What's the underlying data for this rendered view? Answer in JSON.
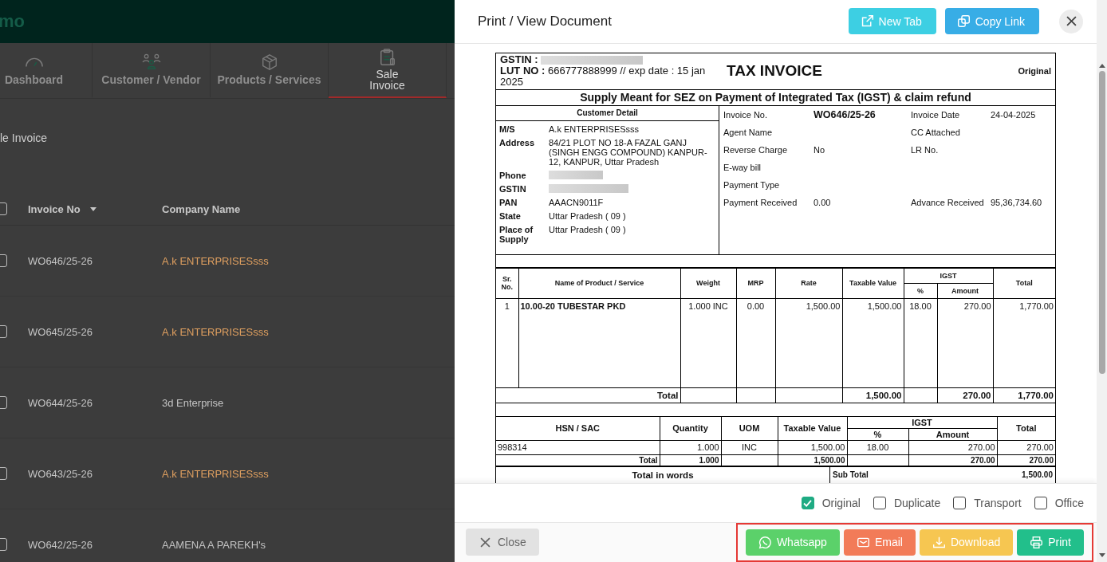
{
  "app": {
    "brand": "mo",
    "tabs": [
      {
        "label": "Dashboard",
        "kind": "gauge",
        "selected": false
      },
      {
        "label": "Customer / Vendor",
        "kind": "people",
        "selected": false
      },
      {
        "label": "Products / Services",
        "kind": "box",
        "selected": false
      },
      {
        "label": "Sale Invoice",
        "kind": "clipboard",
        "selected": true
      }
    ],
    "page_title": "le Invoice",
    "table": {
      "select_all_checked": false,
      "columns": [
        "Invoice No",
        "Company Name"
      ],
      "rows": [
        {
          "checked": false,
          "invoice_no": "WO646/25-26",
          "company": "A.k ENTERPRISESsss",
          "color": "#e0a060"
        },
        {
          "checked": false,
          "invoice_no": "WO645/25-26",
          "company": "A.k ENTERPRISESsss",
          "color": "#e0a060"
        },
        {
          "checked": false,
          "invoice_no": "WO644/25-26",
          "company": "3d Enterprise",
          "color": "#c4c4c4"
        },
        {
          "checked": false,
          "invoice_no": "WO643/25-26",
          "company": "A.k ENTERPRISESsss",
          "color": "#e0a060"
        },
        {
          "checked": false,
          "invoice_no": "WO642/25-26",
          "company": "AAMENA A PAREKH's",
          "color": "#c4c4c4"
        }
      ]
    }
  },
  "modal": {
    "title": "Print / View Document",
    "actions": [
      {
        "kind": "new-tab",
        "label": "New Tab"
      },
      {
        "kind": "copy",
        "label": "Copy Link"
      }
    ],
    "invoice": {
      "gstin_label": "GSTIN :",
      "lut": "**LUT NO :** 666777888999 // exp date : 15 jan 2025",
      "title": "TAX INVOICE",
      "copy_label": "Original",
      "supply_line": "Supply Meant for SEZ on Payment of Integrated Tax (IGST) & claim refund",
      "customer_heading": "Customer Detail",
      "customer_fields": [
        {
          "label": "M/S",
          "value": "A.k ENTERPRISESsss",
          "redacted": false
        },
        {
          "label": "Address",
          "value": "84/21 PLOT NO 18-A FAZAL GANJ (SINGH ENGG COMPOUND) KANPUR-12, KANPUR, Uttar Pradesh",
          "redacted": false
        },
        {
          "label": "Phone",
          "redacted": true
        },
        {
          "label": "GSTIN",
          "redacted": true
        },
        {
          "label": "PAN",
          "value": "AAACN9011F",
          "redacted": false
        },
        {
          "label": "State",
          "value": "Uttar Pradesh ( 09 )",
          "redacted": false
        },
        {
          "label": "Place of Supply",
          "value": "Uttar Pradesh ( 09 )",
          "redacted": false
        }
      ],
      "invoice_fields": [
        {
          "label": "Invoice No.",
          "value": "WO646/25-26",
          "label_2": "Invoice Date",
          "value_2": "24-04-2025"
        },
        {
          "label": "Agent Name",
          "label_2": "CC Attached"
        },
        {
          "label": "Reverse Charge",
          "value": "No",
          "label_2": "LR No."
        },
        {
          "label": "E-way bill"
        },
        {
          "label": "Payment Type"
        },
        {
          "label": "Payment Received",
          "value": "0.00",
          "label_2": "Advance Received",
          "value_2": "95,36,734.60"
        }
      ],
      "item_columns": [
        "Sr. No.",
        "Name of Product / Service",
        "Weight",
        "MRP",
        "Rate",
        "Taxable Value",
        "IGST",
        "%",
        "Amount",
        "Total"
      ],
      "items": [
        [
          "1",
          "10.00-20 TUBESTAR PKD",
          "1.000 INC",
          "0.00",
          "1,500.00",
          "1,500.00",
          "18.00",
          "270.00",
          "1,770.00"
        ]
      ],
      "item_total": {
        "label": "Total",
        "taxable": "1,500.00",
        "amount": "270.00",
        "total": "1,770.00"
      },
      "hsn_columns": [
        "HSN / SAC",
        "Quantity",
        "UOM",
        "Taxable Value",
        "IGST",
        "%",
        "Amount",
        "Total"
      ],
      "hsn_rows": [
        [
          "998314",
          "1.000",
          "INC",
          "1,500.00",
          "18.00",
          "270.00",
          "270.00"
        ]
      ],
      "hsn_total": {
        "label": "Total",
        "quantity": "1.000",
        "taxable": "1,500.00",
        "amount": "270.00",
        "total": "270.00"
      },
      "words_label": "Total in words",
      "sub_total_label": "Sub Total",
      "sub_total": "1,500.00"
    },
    "copies": [
      {
        "label": "Original",
        "checked": true
      },
      {
        "label": "Duplicate",
        "checked": false
      },
      {
        "label": "Transport",
        "checked": false
      },
      {
        "label": "Office",
        "checked": false
      }
    ],
    "close_label": "Close",
    "share_buttons": [
      {
        "kind": "whatsapp",
        "label": "Whatsapp"
      },
      {
        "kind": "email",
        "label": "Email"
      },
      {
        "kind": "download",
        "label": "Download"
      },
      {
        "kind": "print",
        "label": "Print"
      }
    ]
  }
}
